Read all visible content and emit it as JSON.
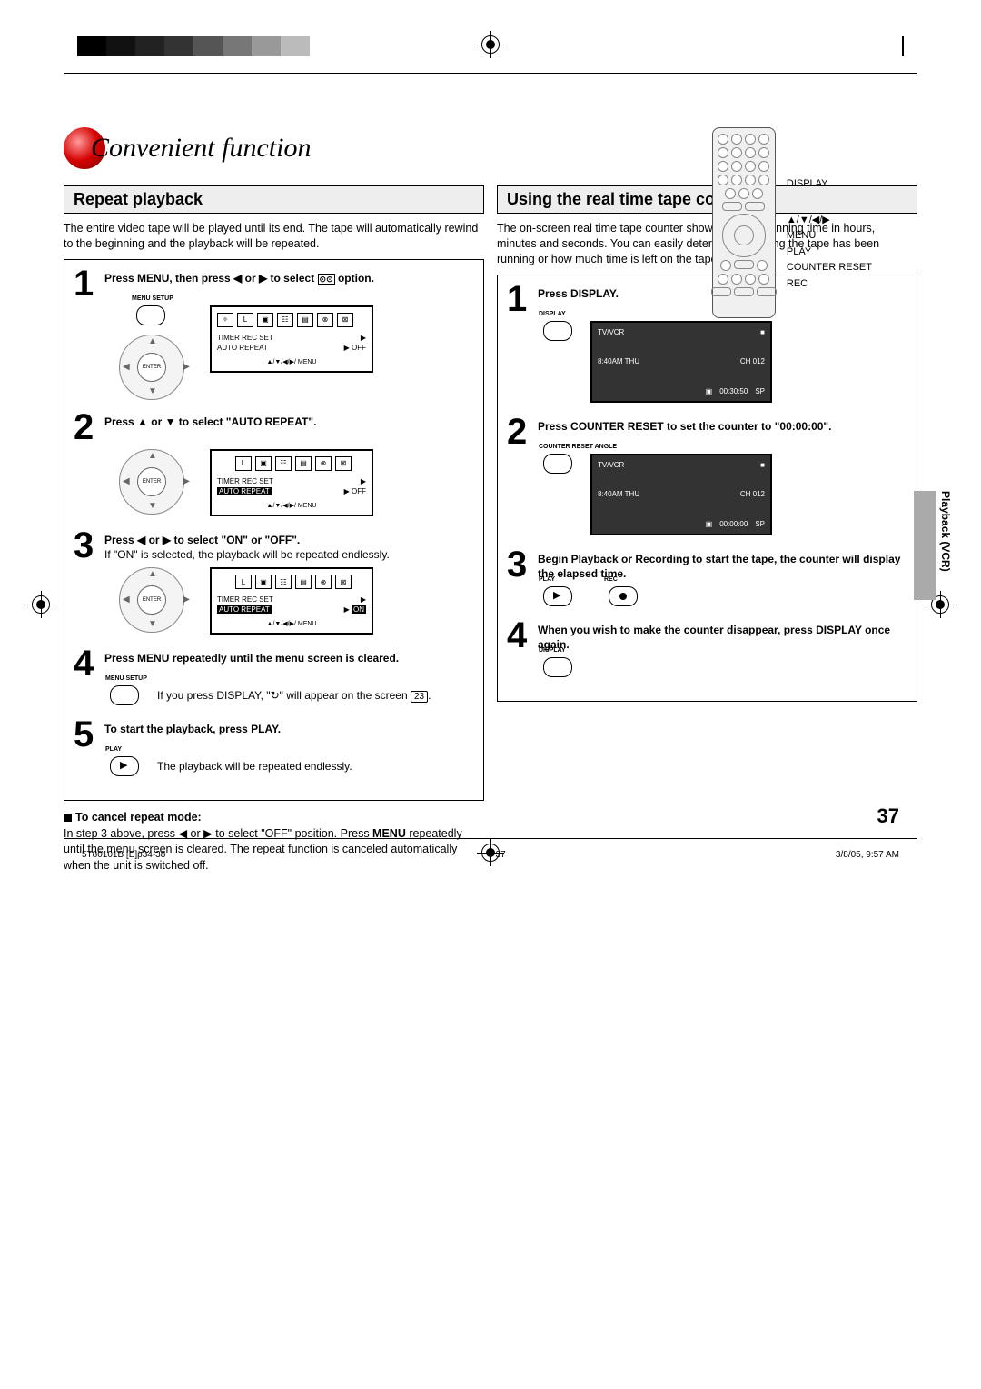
{
  "header": {
    "title": "Convenient function"
  },
  "remote_labels": {
    "display": "DISPLAY",
    "arrows": "▲/▼/◀/▶",
    "menu": "MENU",
    "play": "PLAY",
    "counter_reset": "COUNTER RESET",
    "rec": "REC"
  },
  "left": {
    "heading": "Repeat playback",
    "intro": "The entire video tape will be played until its end. The tape will automatically rewind to the beginning and the playback will be repeated.",
    "steps": [
      {
        "n": "1",
        "text_pre": "Press MENU, then press ◀ or ▶ to select ",
        "text_post": " option.",
        "btn_label": "MENU\nSETUP",
        "osd": {
          "icons": [
            "✧",
            "L",
            "▣",
            "☷",
            "▤",
            "⊗",
            "⊠"
          ],
          "rows": [
            [
              "TIMER REC SET",
              "▶"
            ],
            [
              "AUTO REPEAT",
              "▶ OFF"
            ]
          ],
          "footer": "▲/▼/◀/▶/ MENU"
        }
      },
      {
        "n": "2",
        "text": "Press ▲ or ▼ to select \"AUTO REPEAT\".",
        "osd": {
          "icons": [
            "L",
            "▣",
            "☷",
            "▤",
            "⊗",
            "⊠"
          ],
          "rows": [
            [
              "TIMER REC SET",
              "▶"
            ],
            [
              "AUTO REPEAT",
              "▶ OFF"
            ]
          ],
          "highlight_row": 1,
          "highlight_col": 0,
          "footer": "▲/▼/◀/▶/ MENU"
        }
      },
      {
        "n": "3",
        "text": "Press ◀ or ▶ to select \"ON\" or \"OFF\".",
        "note": "If \"ON\" is selected, the playback will be repeated endlessly.",
        "osd": {
          "icons": [
            "L",
            "▣",
            "☷",
            "▤",
            "⊗",
            "⊠"
          ],
          "rows": [
            [
              "TIMER REC SET",
              "▶"
            ],
            [
              "AUTO REPEAT",
              "▶ ON"
            ]
          ],
          "highlight_row": 1,
          "highlight_col": 0,
          "highlight_val": true,
          "footer": "▲/▼/◀/▶/ MENU"
        }
      },
      {
        "n": "4",
        "text": "Press MENU repeatedly until the menu screen is cleared.",
        "btn_label": "MENU\nSETUP",
        "note_pre": "If you press ",
        "note_bold": "DISPLAY",
        "note_mid": ", \"↻\" will appear on the screen ",
        "page_ref": "23",
        "note_post": "."
      },
      {
        "n": "5",
        "text": "To start the playback, press PLAY.",
        "btn_label": "PLAY",
        "btn_glyph": "▶",
        "note": "The playback will be repeated endlessly."
      }
    ],
    "after": {
      "heading": "To cancel repeat mode:",
      "body_1": "In step 3 above, press ◀ or ▶ to select \"OFF\" position. Press ",
      "body_bold": "MENU",
      "body_2": " repeatedly until the menu screen is cleared. The repeat function is canceled automatically when the unit is switched off."
    }
  },
  "right": {
    "heading": "Using the real time tape counter",
    "intro": "The on-screen real time tape counter shows the tape running time in hours, minutes and seconds. You can easily determine how long the tape has been running or how much time is left on the tape.",
    "steps": [
      {
        "n": "1",
        "text": "Press DISPLAY.",
        "btn_label": "DISPLAY",
        "screen": {
          "tl": "TV/VCR",
          "tr": "■",
          "ml": "8:40AM  THU",
          "mr": "CH 012",
          "bl_icon": "▣",
          "bl": "00:30:50",
          "br": "SP"
        }
      },
      {
        "n": "2",
        "text": "Press COUNTER RESET to set the counter to \"00:00:00\".",
        "btn_label": "COUNTER RESET\nANGLE",
        "screen": {
          "tl": "TV/VCR",
          "tr": "■",
          "ml": "8:40AM  THU",
          "mr": "CH 012",
          "bl_icon": "▣",
          "bl": "00:00:00",
          "br": "SP"
        }
      },
      {
        "n": "3",
        "text": "Begin Playback or Recording to start the tape, the counter will display the elapsed time.",
        "btn_label": "PLAY",
        "btn_glyph": "▶",
        "btn2_label": "REC"
      },
      {
        "n": "4",
        "text": "When you wish to make the counter disappear, press DISPLAY once again.",
        "btn_label": "DISPLAY"
      }
    ]
  },
  "side_tab": "Playback (VCR)",
  "page_number": "37",
  "footer": {
    "doc": "5T80101B [E]p34-38",
    "page": "37",
    "timestamp": "3/8/05, 9:57 AM"
  }
}
